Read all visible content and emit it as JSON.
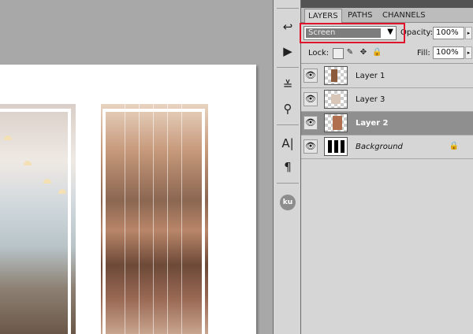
{
  "panel": {
    "tabs": [
      {
        "label": "LAYERS"
      },
      {
        "label": "PATHS"
      },
      {
        "label": "CHANNELS"
      }
    ],
    "blend_mode": "Screen",
    "opacity_label": "Opacity:",
    "opacity_value": "100%",
    "lock_label": "Lock:",
    "fill_label": "Fill:",
    "fill_value": "100%"
  },
  "layers": [
    {
      "name": "Layer 1",
      "visible": true,
      "selected": false
    },
    {
      "name": "Layer 3",
      "visible": true,
      "selected": false
    },
    {
      "name": "Layer 2",
      "visible": true,
      "selected": true
    },
    {
      "name": "Background",
      "visible": true,
      "selected": false,
      "locked": true
    }
  ],
  "toolbar": {
    "icons": [
      "history-icon",
      "actions-play-icon",
      "adjustments-icon",
      "styles-icon",
      "character-icon",
      "paragraph-icon"
    ],
    "ku_badge": "ku"
  },
  "colors": {
    "highlight": "#e0152b",
    "selected_layer": "#8f8f8f"
  }
}
